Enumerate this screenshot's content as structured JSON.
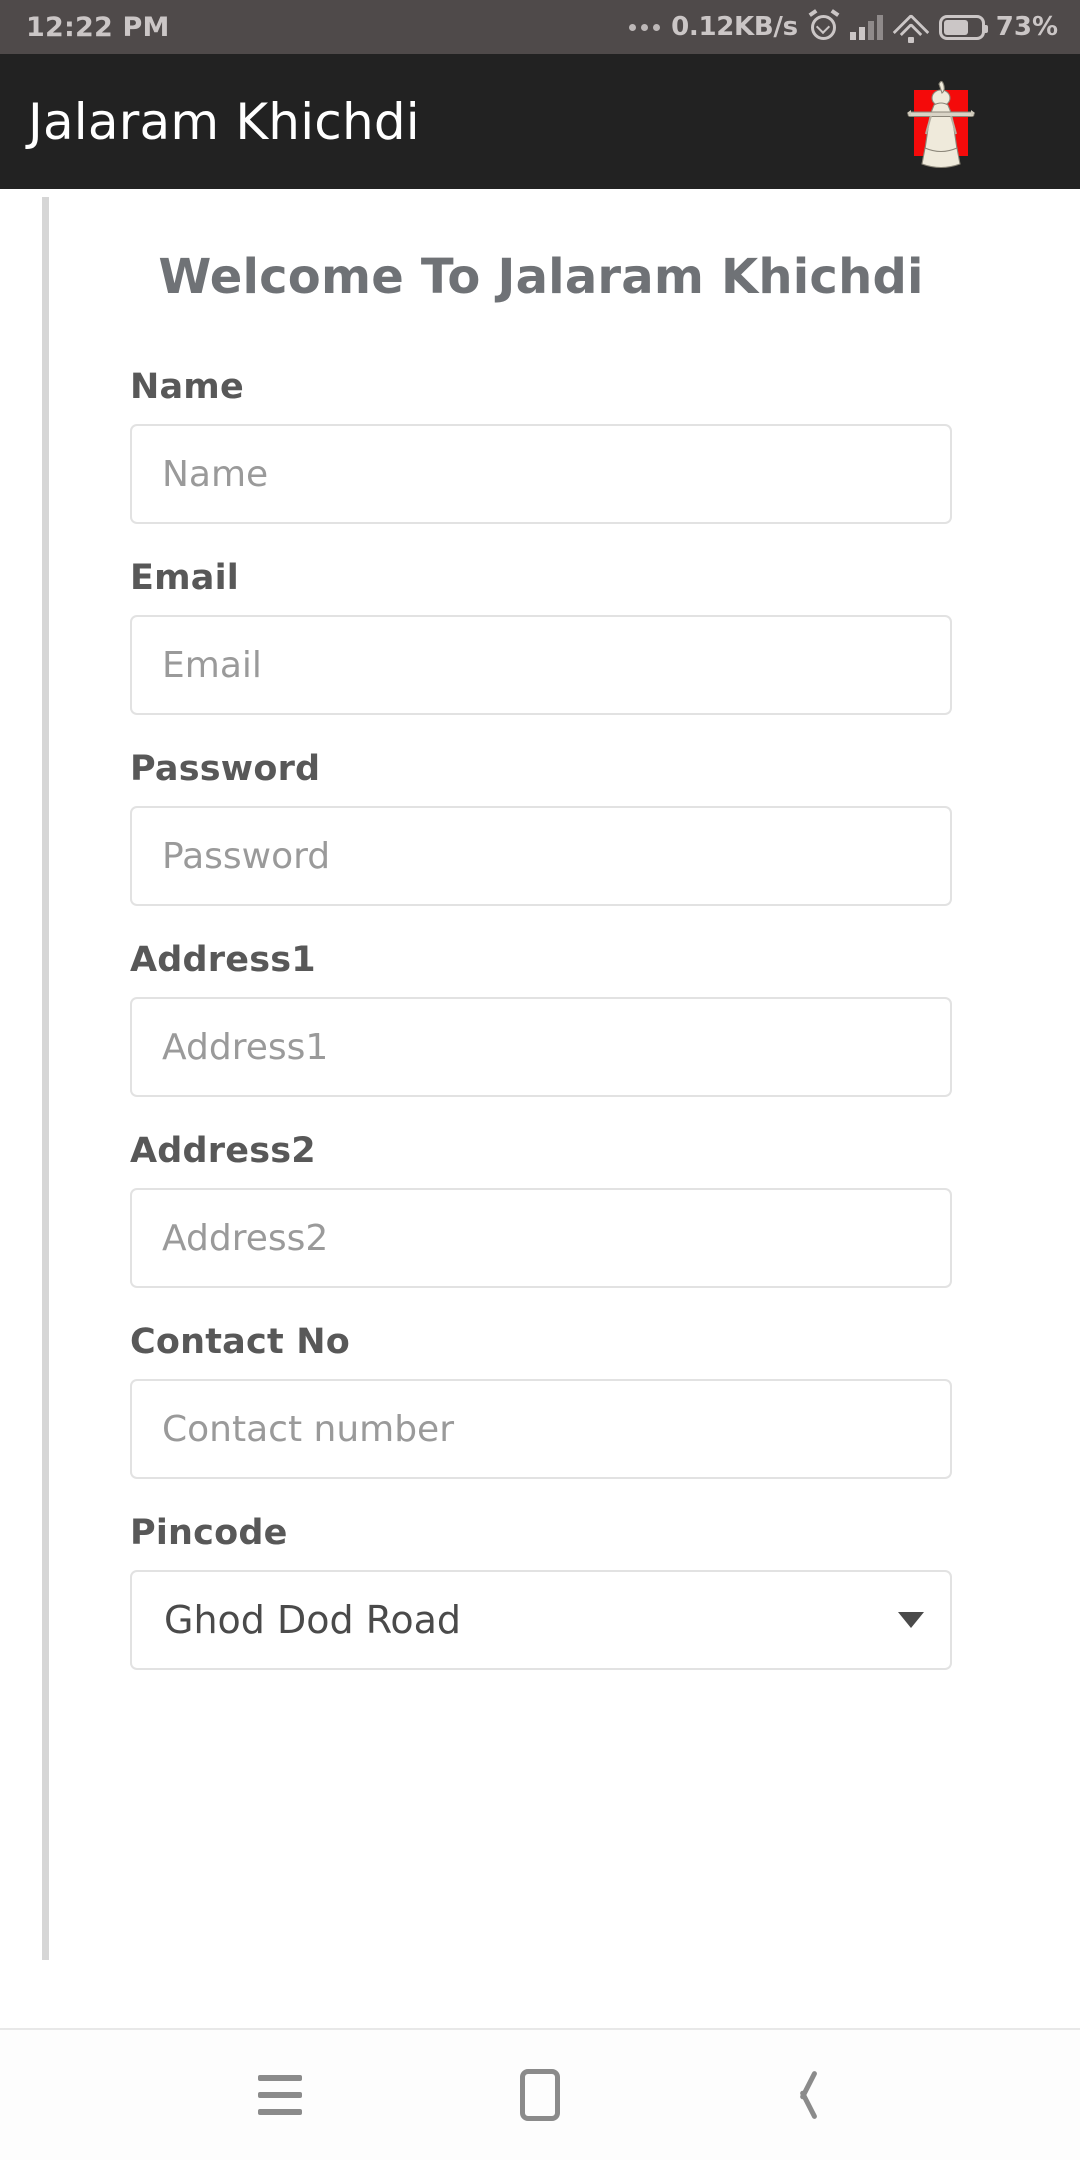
{
  "status_bar": {
    "time": "12:22 PM",
    "network_speed": "0.12KB/s",
    "battery_percent": "73%",
    "icons": [
      "more-dots-icon",
      "alarm-icon",
      "signal-icon",
      "wifi-icon",
      "battery-icon"
    ]
  },
  "app_bar": {
    "title": "Jalaram Khichdi",
    "logo_name": "jalaram-bapa-logo",
    "background_color": "#222222",
    "logo_accent_color": "#f50a0a"
  },
  "page": {
    "heading": "Welcome To Jalaram Khichdi",
    "heading_color": "#6f7276"
  },
  "form": {
    "fields": [
      {
        "label": "Name",
        "placeholder": "Name",
        "value": "",
        "type": "text",
        "name": "name"
      },
      {
        "label": "Email",
        "placeholder": "Email",
        "value": "",
        "type": "email",
        "name": "email"
      },
      {
        "label": "Password",
        "placeholder": "Password",
        "value": "",
        "type": "password",
        "name": "password"
      },
      {
        "label": "Address1",
        "placeholder": "Address1",
        "value": "",
        "type": "text",
        "name": "address1"
      },
      {
        "label": "Address2",
        "placeholder": "Address2",
        "value": "",
        "type": "text",
        "name": "address2"
      },
      {
        "label": "Contact No",
        "placeholder": "Contact number",
        "value": "",
        "type": "tel",
        "name": "contact-no"
      }
    ],
    "pincode": {
      "label": "Pincode",
      "selected": "Ghod Dod Road",
      "name": "pincode"
    }
  },
  "nav_bar": {
    "buttons": [
      {
        "name": "recents-icon",
        "label": "Recents"
      },
      {
        "name": "home-icon",
        "label": "Home"
      },
      {
        "name": "back-icon",
        "label": "Back"
      }
    ]
  }
}
